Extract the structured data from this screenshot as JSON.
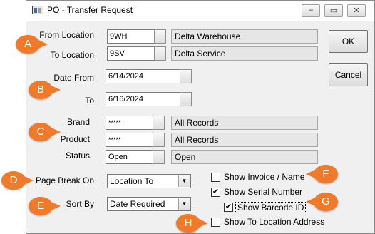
{
  "window": {
    "title": "PO - Transfer Request",
    "minimize_glyph": "–",
    "maximize_glyph": "▭",
    "close_glyph": "✕"
  },
  "form": {
    "from_location": {
      "label": "From Location",
      "code": "9WH",
      "name": "Delta Warehouse"
    },
    "to_location": {
      "label": "To Location",
      "code": "9SV",
      "name": "Delta Service"
    },
    "date_from": {
      "label": "Date From",
      "value": "6/14/2024"
    },
    "date_to": {
      "label": "To",
      "value": "6/16/2024"
    },
    "brand": {
      "label": "Brand",
      "code": "*****",
      "name": "All Records"
    },
    "product": {
      "label": "Product",
      "code": "*****",
      "name": "All Records"
    },
    "status": {
      "label": "Status",
      "code": "Open",
      "name": "Open"
    },
    "page_break": {
      "label": "Page Break On",
      "value": "Location To"
    },
    "sort_by": {
      "label": "Sort By",
      "value": "Date Required"
    }
  },
  "checkboxes": [
    {
      "label": "Show Invoice / Name",
      "checked": false
    },
    {
      "label": "Show Serial Number",
      "checked": true
    },
    {
      "label": "Show Barcode ID",
      "checked": true
    },
    {
      "label": "Show To Location Address",
      "checked": false
    }
  ],
  "buttons": {
    "ok": "OK",
    "cancel": "Cancel"
  },
  "markers": [
    "A",
    "B",
    "C",
    "D",
    "E",
    "F",
    "G",
    "H"
  ],
  "colors": {
    "marker": "#f07a2a",
    "readonly_bg": "#e6e6e6",
    "dialog_bg": "#f0f0f0"
  },
  "icons": {
    "app": "app-icon",
    "dropdown": "chevron-down-icon",
    "check": "check-icon"
  }
}
